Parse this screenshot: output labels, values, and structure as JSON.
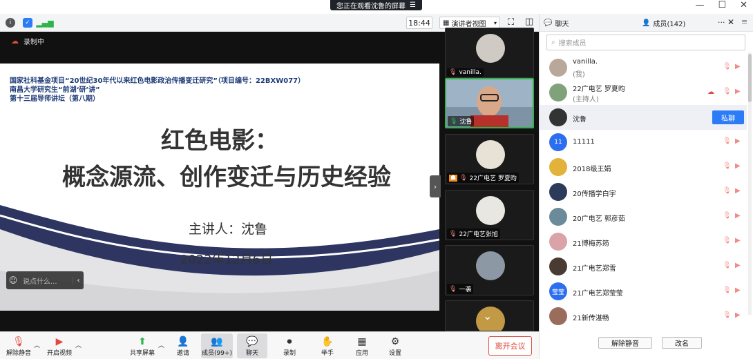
{
  "banner": {
    "text": "您正在观看沈鲁的屏幕",
    "menu_icon": "hamburger-icon"
  },
  "window_controls": {
    "minimize": "—",
    "maximize": "☐",
    "close": "✕"
  },
  "topbar": {
    "time": "18:44",
    "view_mode": "演讲者视图"
  },
  "recording": {
    "label": "录制中"
  },
  "slide": {
    "header_lines": [
      "国家社科基金项目“20世纪30年代以来红色电影政治传播变迁研究”（项目编号：22BXW077）",
      "南昌大学研究生“前湖‘研’讲”",
      "第十三届导师讲坛（第八期）"
    ],
    "title1": "红色电影：",
    "title2": "概念源流、创作变迁与历史经验",
    "speaker": "主讲人：沈鲁",
    "date": "2022年12月6日"
  },
  "chat_input": {
    "placeholder": "说点什么..."
  },
  "video_tiles": [
    {
      "name": "vanilla."
    },
    {
      "name": "沈鲁"
    },
    {
      "name": "22广电艺 罗夏昀"
    },
    {
      "name": "22广电艺张旭"
    },
    {
      "name": "一袭"
    }
  ],
  "toolbar": {
    "unmute": "解除静音",
    "start_video": "开启视频",
    "share_screen": "共享屏幕",
    "invite": "邀请",
    "members": "成员(99+)",
    "chat": "聊天",
    "record": "录制",
    "raise_hand": "举手",
    "apps": "应用",
    "settings": "设置",
    "leave": "离开会议"
  },
  "panel": {
    "tab_chat": "聊天",
    "tab_members": "成员(142)",
    "more": "···",
    "search_placeholder": "搜索成员",
    "members": [
      {
        "name": "vanilla.",
        "sub": "(我)",
        "color": "#b9a89a"
      },
      {
        "name": "22广电艺 罗夏昀",
        "sub": "(主持人)",
        "color": "#7fa27a"
      },
      {
        "name": "沈鲁",
        "sub": "",
        "color": "#333333"
      },
      {
        "name": "11111",
        "sub": "",
        "color": "#2b6ff0",
        "initial": "11"
      },
      {
        "name": "2018级王娟",
        "sub": "",
        "color": "#e2b23b"
      },
      {
        "name": "20传播学白宇",
        "sub": "",
        "color": "#2d3b5a"
      },
      {
        "name": "20广电艺 郭彦茹",
        "sub": "",
        "color": "#6b8a9a"
      },
      {
        "name": "21博梅苏筠",
        "sub": "",
        "color": "#d9a3a8"
      },
      {
        "name": "21广电艺郑雪",
        "sub": "",
        "color": "#4a3b32"
      },
      {
        "name": "21广电艺郑莹莹",
        "sub": "",
        "color": "#2b6ff0",
        "initial": "莹莹"
      },
      {
        "name": "21新传湛畅",
        "sub": "",
        "color": "#9a6c5c"
      }
    ],
    "private_chat": "私聊",
    "unmute_all": "解除静音",
    "rename": "改名"
  }
}
